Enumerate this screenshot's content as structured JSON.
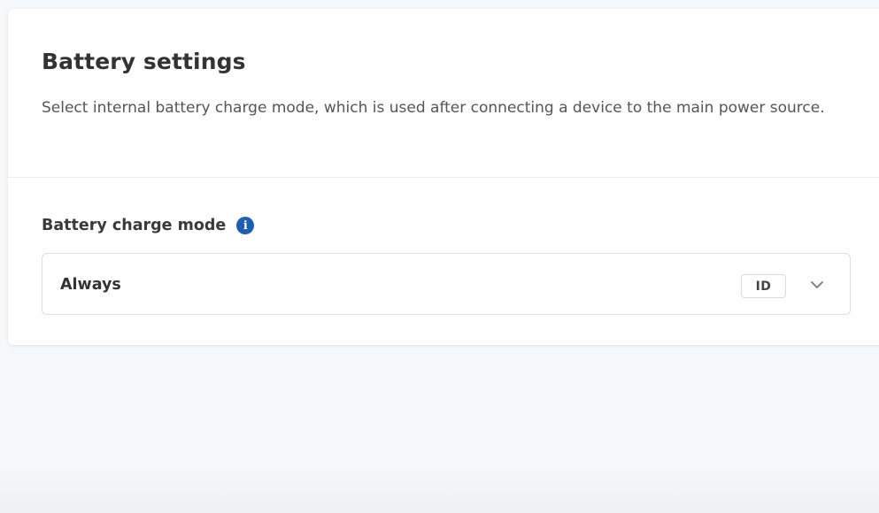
{
  "section": {
    "title": "Battery settings",
    "description": "Select internal battery charge mode, which is used after connecting a device to the main power source."
  },
  "field": {
    "label": "Battery charge mode",
    "info_icon": "info-icon",
    "info_glyph": "i",
    "selected_value": "Always",
    "id_badge": "ID",
    "dropdown_icon": "chevron-down-icon"
  },
  "colors": {
    "info_icon": "#1f5fae",
    "card_background": "#ffffff",
    "page_background": "#f7f8fa"
  }
}
